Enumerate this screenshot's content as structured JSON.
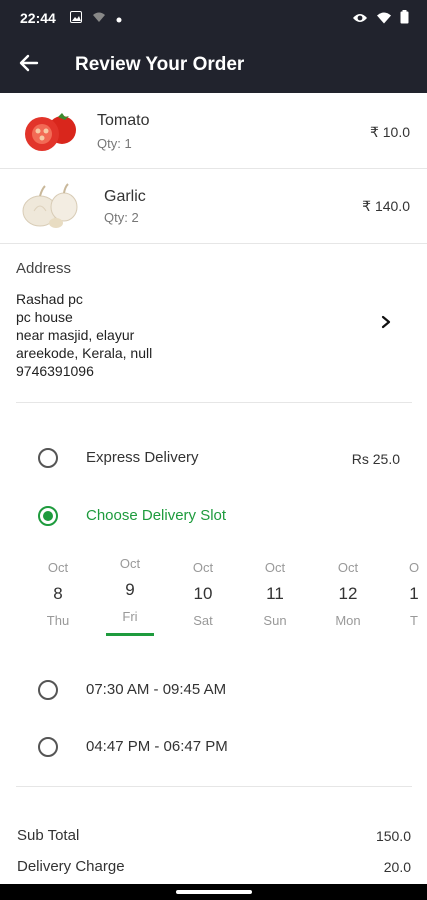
{
  "status_bar": {
    "time": "22:44",
    "icons": [
      "image-icon",
      "wifi-off-icon",
      "dot-icon",
      "eye-icon",
      "wifi-icon",
      "battery-icon"
    ]
  },
  "app_bar": {
    "title": "Review Your Order",
    "back_icon": "arrow-left-icon"
  },
  "items": [
    {
      "name": "Tomato",
      "qty": "Qty: 1",
      "price": "₹ 10.0",
      "image": "tomato-image"
    },
    {
      "name": "Garlic",
      "qty": "Qty: 2",
      "price": "₹ 140.0",
      "image": "garlic-image"
    }
  ],
  "address": {
    "label": "Address",
    "lines": [
      "Rashad pc",
      "pc house",
      "near masjid, elayur",
      "areekode, Kerala, null",
      "9746391096"
    ]
  },
  "delivery": {
    "express_label": "Express Delivery",
    "express_price": "Rs 25.0",
    "slot_label": "Choose Delivery Slot",
    "selected_option": "slot"
  },
  "dates": [
    {
      "month": "Oct",
      "day": "8",
      "week": "Thu"
    },
    {
      "month": "Oct",
      "day": "9",
      "week": "Fri",
      "selected": true
    },
    {
      "month": "Oct",
      "day": "10",
      "week": "Sat"
    },
    {
      "month": "Oct",
      "day": "11",
      "week": "Sun"
    },
    {
      "month": "Oct",
      "day": "12",
      "week": "Mon"
    },
    {
      "month": "O",
      "day": "1",
      "week": "T"
    }
  ],
  "time_slots": [
    "07:30 AM - 09:45 AM",
    "04:47 PM - 06:47 PM"
  ],
  "totals": {
    "subtotal_label": "Sub Total",
    "subtotal_value": "150.0",
    "delivery_label": "Delivery Charge",
    "delivery_value": "20.0"
  },
  "colors": {
    "primary_green": "#1e9b3d",
    "app_bar": "#21232d"
  }
}
